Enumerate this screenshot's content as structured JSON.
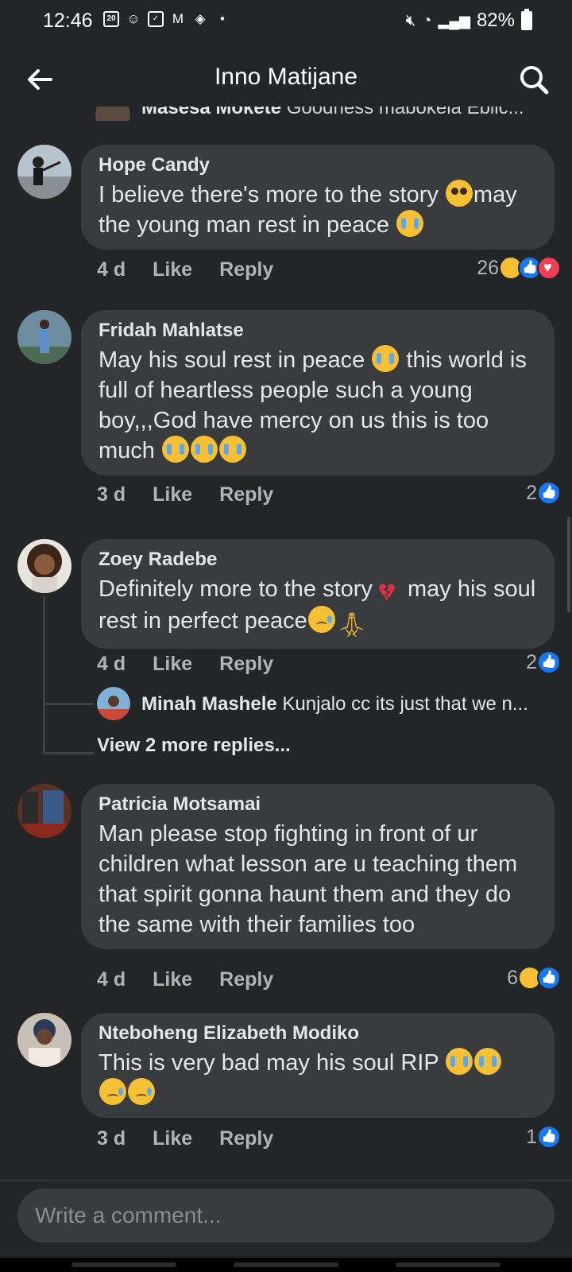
{
  "status_bar": {
    "time": "12:46",
    "calendar_day": "20",
    "battery": "82%"
  },
  "header": {
    "title": "Inno Matijane"
  },
  "clipped_comment": {
    "author": "Masesa Mokete",
    "text": "Goodness mabokela Eblic..."
  },
  "comments": [
    {
      "author": "Hope Candy",
      "text_parts": [
        "I believe there's more to the story ",
        "may the young man rest in peace "
      ],
      "time": "4 d",
      "like_label": "Like",
      "reply_label": "Reply",
      "reaction_count": "26",
      "reactions": [
        "sad",
        "like",
        "love"
      ]
    },
    {
      "author": "Fridah Mahlatse",
      "text_parts": [
        "May his soul rest in peace ",
        " this world is full of heartless people such a young boy,,,God have mercy on us this is too much "
      ],
      "time": "3 d",
      "like_label": "Like",
      "reply_label": "Reply",
      "reaction_count": "2",
      "reactions": [
        "like"
      ]
    },
    {
      "author": "Zoey Radebe",
      "text_parts": [
        "Definitely more to the story",
        " may his soul rest in perfect peace"
      ],
      "time": "4 d",
      "like_label": "Like",
      "reply_label": "Reply",
      "reaction_count": "2",
      "reactions": [
        "like"
      ],
      "reply_preview": {
        "author": "Minah Mashele",
        "text": "Kunjalo cc its just that we n..."
      },
      "view_more": "View 2 more replies..."
    },
    {
      "author": "Patricia Motsamai",
      "text_parts": [
        "Man please stop fighting in front of ur children what lesson are u teaching them that spirit gonna haunt them and they do the same with their families too"
      ],
      "time": "4 d",
      "like_label": "Like",
      "reply_label": "Reply",
      "reaction_count": "6",
      "reactions": [
        "sad",
        "like"
      ]
    },
    {
      "author": "Nteboheng Elizabeth Modiko",
      "text_parts": [
        "This is very bad may his soul RIP "
      ],
      "time": "3 d",
      "like_label": "Like",
      "reply_label": "Reply",
      "reaction_count": "1",
      "reactions": [
        "like"
      ]
    }
  ],
  "composer": {
    "placeholder": "Write a comment..."
  },
  "colors": {
    "background": "#242526",
    "bubble": "#3a3b3c",
    "like_blue": "#1877f2",
    "love_red": "#f33e58"
  }
}
